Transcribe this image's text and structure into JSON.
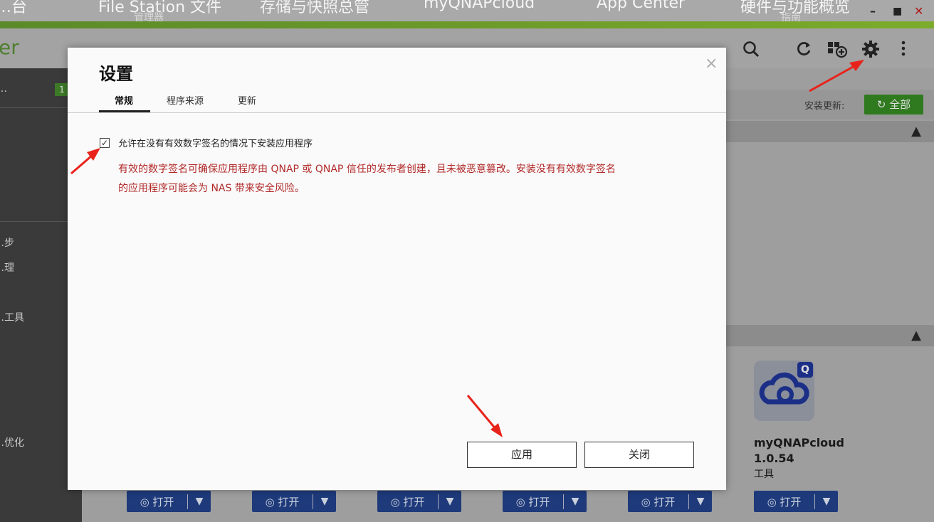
{
  "taskbar": {
    "tasks": [
      "…台",
      "File Station 文件",
      "存储与快照总管",
      "myQNAPcloud",
      "App Center",
      "硬件与功能概览"
    ],
    "subtitles": [
      "管理器",
      "指南"
    ],
    "window_controls": {
      "minimize": "–",
      "maximize": "■",
      "close": "✕"
    }
  },
  "app": {
    "logo_fragment": "er",
    "header_icons": [
      "search-icon",
      "refresh-icon",
      "install-manual-icon",
      "settings-icon",
      "more-icon"
    ]
  },
  "sidebar": {
    "badge": "1",
    "items": [
      "…步",
      "…理",
      "…工具",
      "…优化"
    ],
    "first_fragment": "…"
  },
  "main": {
    "update_label": "安装更新:",
    "update_all_label": "全部",
    "app_card": {
      "name": "myQNAPcloud",
      "version": "1.0.54",
      "category": "工具",
      "icon_badge": "Q"
    },
    "open_label": "打开",
    "open_buttons_count": 6
  },
  "dialog": {
    "title": "设置",
    "tabs": [
      "常规",
      "程序来源",
      "更新"
    ],
    "active_tab": 0,
    "checkbox_checked": true,
    "checkbox_label": "允许在没有有效数字签名的情况下安装应用程序",
    "warning_line1": "有效的数字签名可确保应用程序由 QNAP 或 QNAP 信任的发布者创建，且未被恶意篡改。安装没有有效数字签名",
    "warning_line2": "的应用程序可能会为 NAS 带来安全风险。",
    "apply_label": "应用",
    "close_label": "关闭",
    "close_icon": "×"
  },
  "colors": {
    "warning": "#b22a2a",
    "accent_green": "#7dab2b",
    "open_button": "#1e3a7a",
    "annotation": "#e8231b"
  }
}
